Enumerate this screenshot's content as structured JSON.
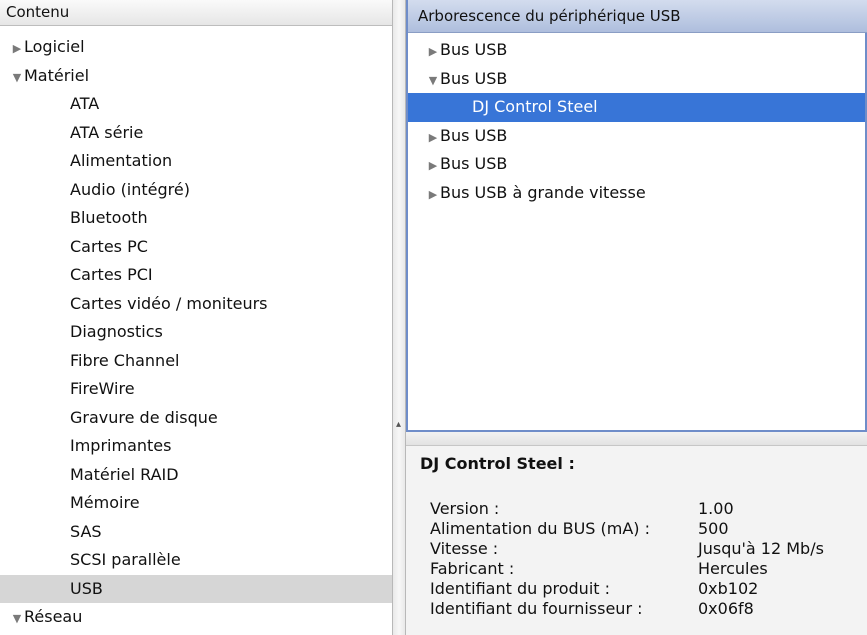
{
  "sidebar": {
    "header": "Contenu",
    "items": [
      {
        "label": "Logiciel",
        "level": 0,
        "expander": "collapsed",
        "selected": false
      },
      {
        "label": "Matériel",
        "level": 0,
        "expander": "expanded",
        "selected": false
      },
      {
        "label": "ATA",
        "level": 1,
        "expander": "none",
        "selected": false
      },
      {
        "label": "ATA série",
        "level": 1,
        "expander": "none",
        "selected": false
      },
      {
        "label": "Alimentation",
        "level": 1,
        "expander": "none",
        "selected": false
      },
      {
        "label": "Audio (intégré)",
        "level": 1,
        "expander": "none",
        "selected": false
      },
      {
        "label": "Bluetooth",
        "level": 1,
        "expander": "none",
        "selected": false
      },
      {
        "label": "Cartes PC",
        "level": 1,
        "expander": "none",
        "selected": false
      },
      {
        "label": "Cartes PCI",
        "level": 1,
        "expander": "none",
        "selected": false
      },
      {
        "label": "Cartes vidéo / moniteurs",
        "level": 1,
        "expander": "none",
        "selected": false
      },
      {
        "label": "Diagnostics",
        "level": 1,
        "expander": "none",
        "selected": false
      },
      {
        "label": "Fibre Channel",
        "level": 1,
        "expander": "none",
        "selected": false
      },
      {
        "label": "FireWire",
        "level": 1,
        "expander": "none",
        "selected": false
      },
      {
        "label": "Gravure de disque",
        "level": 1,
        "expander": "none",
        "selected": false
      },
      {
        "label": "Imprimantes",
        "level": 1,
        "expander": "none",
        "selected": false
      },
      {
        "label": "Matériel RAID",
        "level": 1,
        "expander": "none",
        "selected": false
      },
      {
        "label": "Mémoire",
        "level": 1,
        "expander": "none",
        "selected": false
      },
      {
        "label": "SAS",
        "level": 1,
        "expander": "none",
        "selected": false
      },
      {
        "label": "SCSI parallèle",
        "level": 1,
        "expander": "none",
        "selected": false
      },
      {
        "label": "USB",
        "level": 1,
        "expander": "none",
        "selected": true
      },
      {
        "label": "Réseau",
        "level": 0,
        "expander": "expanded",
        "selected": false
      }
    ]
  },
  "usb_tree": {
    "header": "Arborescence du périphérique USB",
    "items": [
      {
        "label": "Bus USB",
        "child": false,
        "expander": "collapsed",
        "selected": false
      },
      {
        "label": "Bus USB",
        "child": false,
        "expander": "expanded",
        "selected": false
      },
      {
        "label": "DJ Control Steel",
        "child": true,
        "expander": "none",
        "selected": true
      },
      {
        "label": "Bus USB",
        "child": false,
        "expander": "collapsed",
        "selected": false
      },
      {
        "label": "Bus USB",
        "child": false,
        "expander": "collapsed",
        "selected": false
      },
      {
        "label": "Bus USB à grande vitesse",
        "child": false,
        "expander": "collapsed",
        "selected": false
      }
    ]
  },
  "details": {
    "title": "DJ Control Steel :",
    "properties": [
      {
        "label": "Version :",
        "value": "1.00"
      },
      {
        "label": "Alimentation du BUS (mA) :",
        "value": "500"
      },
      {
        "label": "Vitesse :",
        "value": "Jusqu'à 12 Mb/s"
      },
      {
        "label": "Fabricant :",
        "value": "Hercules"
      },
      {
        "label": "Identifiant du produit :",
        "value": "0xb102"
      },
      {
        "label": "Identifiant du fournisseur :",
        "value": "0x06f8"
      }
    ]
  },
  "colors": {
    "selection_blue": "#3875d7",
    "selection_gray": "#d6d6d6",
    "header_blue": "#aebedd"
  },
  "icons": {
    "collapsed": "disclosure-triangle-right-icon",
    "expanded": "disclosure-triangle-down-icon"
  }
}
